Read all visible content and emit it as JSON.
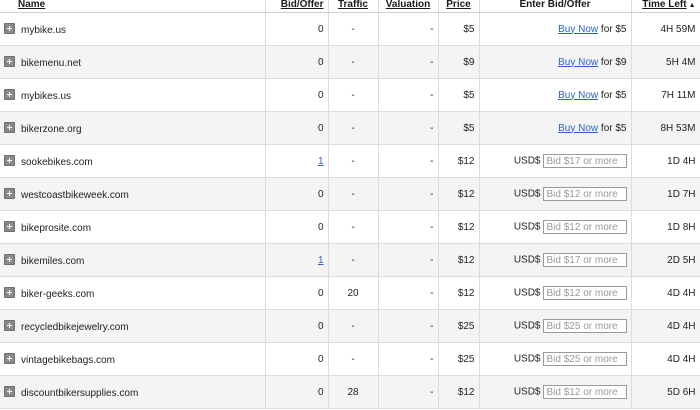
{
  "columns": {
    "name": "Name",
    "bid_offer": "Bid/Offer",
    "traffic": "Traffic",
    "valuation": "Valuation",
    "price": "Price",
    "enter_bid": "Enter Bid/Offer",
    "time_left": "Time Left",
    "sort_icon": "triangle-up-icon"
  },
  "colors": {
    "link": "#2a63c8",
    "row_alt": "#f4f4f4",
    "grid": "#dcdcdc"
  },
  "rows": [
    {
      "name": "mybike.us",
      "bids": "0",
      "bids_link": false,
      "traffic": "-",
      "valuation": "-",
      "price": "$5",
      "action": "buy",
      "buy_label": "Buy Now",
      "buy_suffix": "for $5",
      "time": "4H 59M"
    },
    {
      "name": "bikemenu.net",
      "bids": "0",
      "bids_link": false,
      "traffic": "-",
      "valuation": "-",
      "price": "$9",
      "action": "buy",
      "buy_label": "Buy Now",
      "buy_suffix": "for $9",
      "time": "5H 4M"
    },
    {
      "name": "mybikes.us",
      "bids": "0",
      "bids_link": false,
      "traffic": "-",
      "valuation": "-",
      "price": "$5",
      "action": "buy",
      "buy_label": "Buy Now",
      "buy_suffix": "for $5",
      "time": "7H 11M"
    },
    {
      "name": "bikerzone.org",
      "bids": "0",
      "bids_link": false,
      "traffic": "-",
      "valuation": "-",
      "price": "$5",
      "action": "buy",
      "buy_label": "Buy Now",
      "buy_suffix": "for $5",
      "time": "8H 53M"
    },
    {
      "name": "sookebikes.com",
      "bids": "1",
      "bids_link": true,
      "traffic": "-",
      "valuation": "-",
      "price": "$12",
      "action": "bid",
      "currency": "USD$",
      "placeholder": "Bid $17 or more",
      "time": "1D 4H"
    },
    {
      "name": "westcoastbikeweek.com",
      "bids": "0",
      "bids_link": false,
      "traffic": "-",
      "valuation": "-",
      "price": "$12",
      "action": "bid",
      "currency": "USD$",
      "placeholder": "Bid $12 or more",
      "time": "1D 7H"
    },
    {
      "name": "bikeprosite.com",
      "bids": "0",
      "bids_link": false,
      "traffic": "-",
      "valuation": "-",
      "price": "$12",
      "action": "bid",
      "currency": "USD$",
      "placeholder": "Bid $12 or more",
      "time": "1D 8H"
    },
    {
      "name": "bikemiles.com",
      "bids": "1",
      "bids_link": true,
      "traffic": "-",
      "valuation": "-",
      "price": "$12",
      "action": "bid",
      "currency": "USD$",
      "placeholder": "Bid $17 or more",
      "time": "2D 5H"
    },
    {
      "name": "biker-geeks.com",
      "bids": "0",
      "bids_link": false,
      "traffic": "20",
      "valuation": "-",
      "price": "$12",
      "action": "bid",
      "currency": "USD$",
      "placeholder": "Bid $12 or more",
      "time": "4D 4H"
    },
    {
      "name": "recycledbikejewelry.com",
      "bids": "0",
      "bids_link": false,
      "traffic": "-",
      "valuation": "-",
      "price": "$25",
      "action": "bid",
      "currency": "USD$",
      "placeholder": "Bid $25 or more",
      "time": "4D 4H"
    },
    {
      "name": "vintagebikebags.com",
      "bids": "0",
      "bids_link": false,
      "traffic": "-",
      "valuation": "-",
      "price": "$25",
      "action": "bid",
      "currency": "USD$",
      "placeholder": "Bid $25 or more",
      "time": "4D 4H"
    },
    {
      "name": "discountbikersupplies.com",
      "bids": "0",
      "bids_link": false,
      "traffic": "28",
      "valuation": "-",
      "price": "$12",
      "action": "bid",
      "currency": "USD$",
      "placeholder": "Bid $12 or more",
      "time": "5D 6H"
    }
  ]
}
